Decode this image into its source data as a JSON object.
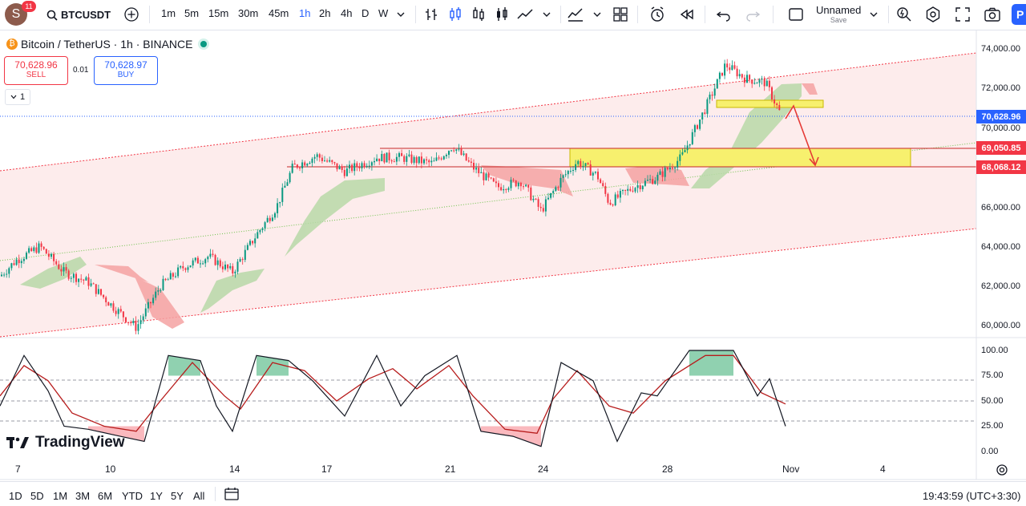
{
  "topbar": {
    "avatar_letter": "S",
    "notification_count": "11",
    "symbol": "BTCUSDT",
    "intervals": [
      "1m",
      "5m",
      "15m",
      "30m",
      "45m",
      "1h",
      "2h",
      "4h",
      "D",
      "W"
    ],
    "active_interval": "1h",
    "layout_name": "Unnamed",
    "save_label": "Save"
  },
  "legend": {
    "title": "Bitcoin / TetherUS · 1h · BINANCE",
    "sell_price": "70,628.96",
    "sell_label": "SELL",
    "spread": "0.01",
    "buy_price": "70,628.97",
    "buy_label": "BUY",
    "collapse_count": "1"
  },
  "price_axis": {
    "labels": [
      "74,000.00",
      "72,000.00",
      "70,000.00",
      "66,000.00",
      "64,000.00",
      "62,000.00",
      "60,000.00"
    ],
    "current_price": "70,628.96",
    "level_1": "69,050.85",
    "level_2": "68,068.12",
    "current_color": "#2962ff",
    "level_color": "#f23645"
  },
  "oscillator_axis": {
    "labels": [
      "100.00",
      "75.00",
      "50.00",
      "25.00",
      "0.00"
    ]
  },
  "time_axis": {
    "labels": [
      "7",
      "10",
      "14",
      "17",
      "21",
      "24",
      "28",
      "Nov",
      "4"
    ]
  },
  "branding": {
    "logo_text": "TradingView"
  },
  "bottombar": {
    "ranges": [
      "1D",
      "5D",
      "1M",
      "3M",
      "6M",
      "YTD",
      "1Y",
      "5Y",
      "All"
    ],
    "clock": "19:43:59 (UTC+3:30)"
  },
  "colors": {
    "accent": "#2962ff",
    "bull": "#089981",
    "bear": "#f23645",
    "zone_fill": "#f7f06e",
    "channel_fill": "#fdecec"
  },
  "chart_data": {
    "type": "candlestick",
    "symbol": "BTCUSDT",
    "interval": "1h",
    "y_range": [
      59500,
      75000
    ],
    "x_labels": [
      "7",
      "10",
      "14",
      "17",
      "21",
      "24",
      "28",
      "Nov",
      "4"
    ],
    "close_path": [
      [
        0,
        62500
      ],
      [
        20,
        63300
      ],
      [
        50,
        64000
      ],
      [
        80,
        62700
      ],
      [
        110,
        62200
      ],
      [
        140,
        61000
      ],
      [
        170,
        59900
      ],
      [
        200,
        62000
      ],
      [
        230,
        63000
      ],
      [
        260,
        63500
      ],
      [
        290,
        62700
      ],
      [
        320,
        64600
      ],
      [
        345,
        66000
      ],
      [
        365,
        68000
      ],
      [
        395,
        68600
      ],
      [
        430,
        67800
      ],
      [
        470,
        68500
      ],
      [
        500,
        68500
      ],
      [
        540,
        68200
      ],
      [
        565,
        69100
      ],
      [
        590,
        68000
      ],
      [
        620,
        67000
      ],
      [
        650,
        67300
      ],
      [
        675,
        65800
      ],
      [
        700,
        67400
      ],
      [
        720,
        68300
      ],
      [
        745,
        67600
      ],
      [
        760,
        66200
      ],
      [
        790,
        67000
      ],
      [
        820,
        67500
      ],
      [
        850,
        68500
      ],
      [
        880,
        71000
      ],
      [
        905,
        73200
      ],
      [
        930,
        72500
      ],
      [
        955,
        72300
      ],
      [
        975,
        70600
      ]
    ],
    "levels": [
      {
        "name": "current",
        "value": 70628.96
      },
      {
        "name": "resistance",
        "value": 69050.85
      },
      {
        "name": "support",
        "value": 68068.12
      }
    ],
    "oscillator": {
      "range": [
        0,
        100
      ],
      "reference_lines": [
        75,
        50,
        25
      ],
      "k_path": [
        [
          0,
          45
        ],
        [
          30,
          95
        ],
        [
          60,
          60
        ],
        [
          80,
          25
        ],
        [
          110,
          22
        ],
        [
          150,
          15
        ],
        [
          180,
          10
        ],
        [
          210,
          95
        ],
        [
          250,
          90
        ],
        [
          270,
          45
        ],
        [
          290,
          20
        ],
        [
          320,
          95
        ],
        [
          360,
          90
        ],
        [
          390,
          70
        ],
        [
          430,
          35
        ],
        [
          470,
          95
        ],
        [
          500,
          45
        ],
        [
          530,
          75
        ],
        [
          570,
          95
        ],
        [
          600,
          20
        ],
        [
          640,
          15
        ],
        [
          675,
          5
        ],
        [
          700,
          88
        ],
        [
          740,
          70
        ],
        [
          770,
          10
        ],
        [
          800,
          58
        ],
        [
          820,
          55
        ],
        [
          860,
          100
        ],
        [
          915,
          100
        ],
        [
          945,
          55
        ],
        [
          960,
          72
        ],
        [
          980,
          25
        ]
      ],
      "d_path": [
        [
          0,
          55
        ],
        [
          30,
          85
        ],
        [
          60,
          70
        ],
        [
          90,
          38
        ],
        [
          130,
          25
        ],
        [
          170,
          20
        ],
        [
          200,
          50
        ],
        [
          240,
          88
        ],
        [
          280,
          55
        ],
        [
          300,
          42
        ],
        [
          340,
          88
        ],
        [
          380,
          80
        ],
        [
          420,
          50
        ],
        [
          460,
          72
        ],
        [
          490,
          82
        ],
        [
          520,
          62
        ],
        [
          560,
          85
        ],
        [
          590,
          55
        ],
        [
          630,
          22
        ],
        [
          670,
          18
        ],
        [
          690,
          52
        ],
        [
          720,
          80
        ],
        [
          760,
          45
        ],
        [
          790,
          38
        ],
        [
          830,
          70
        ],
        [
          880,
          95
        ],
        [
          915,
          95
        ],
        [
          950,
          58
        ],
        [
          980,
          47
        ]
      ]
    }
  }
}
